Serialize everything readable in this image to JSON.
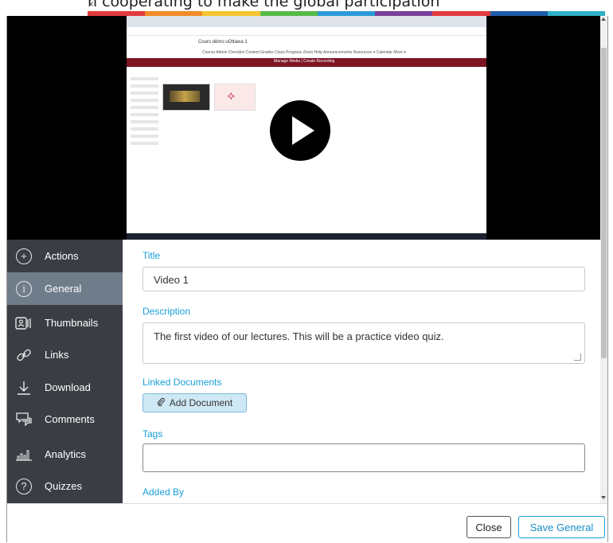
{
  "page": {
    "caption": "h cooperating to make the global participation"
  },
  "colors": {
    "accent": "#1a9fd9",
    "sidebar": "#3a3d44",
    "sidebar_active": "#6f7d8a"
  },
  "video": {
    "course_title": "Cours démo uOttawa 1",
    "nav_text": "Course Admin  Checklist  Content  Grades  Class Progress  Zoom  Help  Announcements  Resources ▾  Calendar  More ▾",
    "media_bar": "Manage Media | Create Recording",
    "state": "paused"
  },
  "sidebar": {
    "items": [
      {
        "label": "Actions",
        "icon": "plus-circle-icon"
      },
      {
        "label": "General",
        "icon": "info-circle-icon",
        "active": true
      },
      {
        "label": "Thumbnails",
        "icon": "thumbnails-icon"
      },
      {
        "label": "Links",
        "icon": "link-icon"
      },
      {
        "label": "Download",
        "icon": "download-icon"
      },
      {
        "label": "Comments",
        "icon": "comments-icon"
      },
      {
        "label": "Analytics",
        "icon": "analytics-icon"
      },
      {
        "label": "Quizzes",
        "icon": "question-circle-icon"
      }
    ]
  },
  "form": {
    "title_label": "Title",
    "title_value": "Video 1",
    "description_label": "Description",
    "description_value": "The first video of our lectures. This will be a practice video quiz.",
    "linked_label": "Linked Documents",
    "add_document": "Add Document",
    "tags_label": "Tags",
    "tags_value": "",
    "added_by_label": "Added By"
  },
  "footer": {
    "close": "Close",
    "save": "Save General"
  }
}
